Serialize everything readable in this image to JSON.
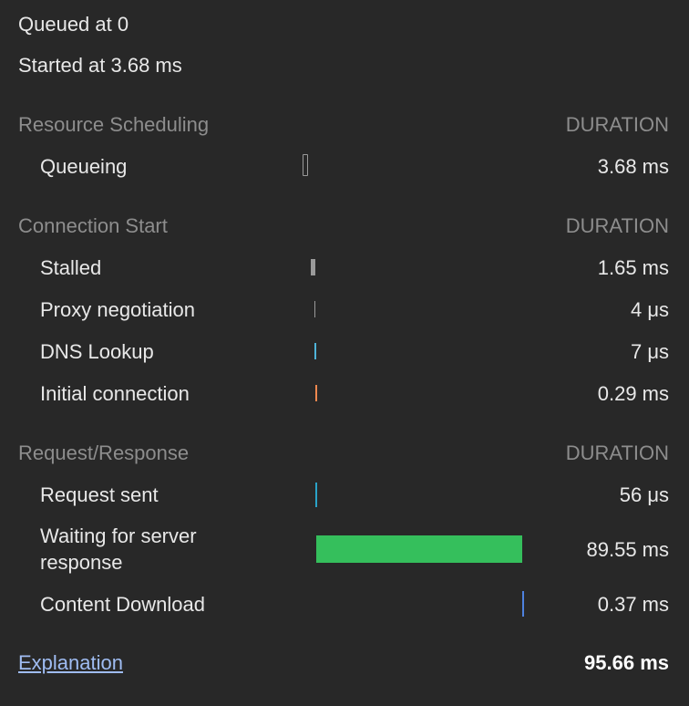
{
  "header": {
    "queued_at": "Queued at 0",
    "started_at": "Started at 3.68 ms"
  },
  "sections": {
    "resource_scheduling": {
      "title": "Resource Scheduling",
      "duration_header": "DURATION",
      "rows": [
        {
          "label": "Queueing",
          "value": "3.68 ms"
        }
      ]
    },
    "connection_start": {
      "title": "Connection Start",
      "duration_header": "DURATION",
      "rows": [
        {
          "label": "Stalled",
          "value": "1.65 ms"
        },
        {
          "label": "Proxy negotiation",
          "value": "4 μs"
        },
        {
          "label": "DNS Lookup",
          "value": "7 μs"
        },
        {
          "label": "Initial connection",
          "value": "0.29 ms"
        }
      ]
    },
    "request_response": {
      "title": "Request/Response",
      "duration_header": "DURATION",
      "rows": [
        {
          "label": "Request sent",
          "value": "56 μs"
        },
        {
          "label": "Waiting for server response",
          "value": "89.55 ms"
        },
        {
          "label": "Content Download",
          "value": "0.37 ms"
        }
      ]
    }
  },
  "footer": {
    "explanation_link": "Explanation",
    "total": "95.66 ms"
  },
  "colors": {
    "background": "#282828",
    "queueing_bar": "#9a9a9a",
    "stalled_bar": "#9a9a9a",
    "proxy_bar": "#9a9a9a",
    "dns_bar": "#4fb3d9",
    "initial_connection_bar": "#f0884f",
    "request_sent_bar": "#2aa3c8",
    "waiting_bar": "#35bf5c",
    "content_download_bar": "#4e82df",
    "link": "#9fbcf2"
  }
}
